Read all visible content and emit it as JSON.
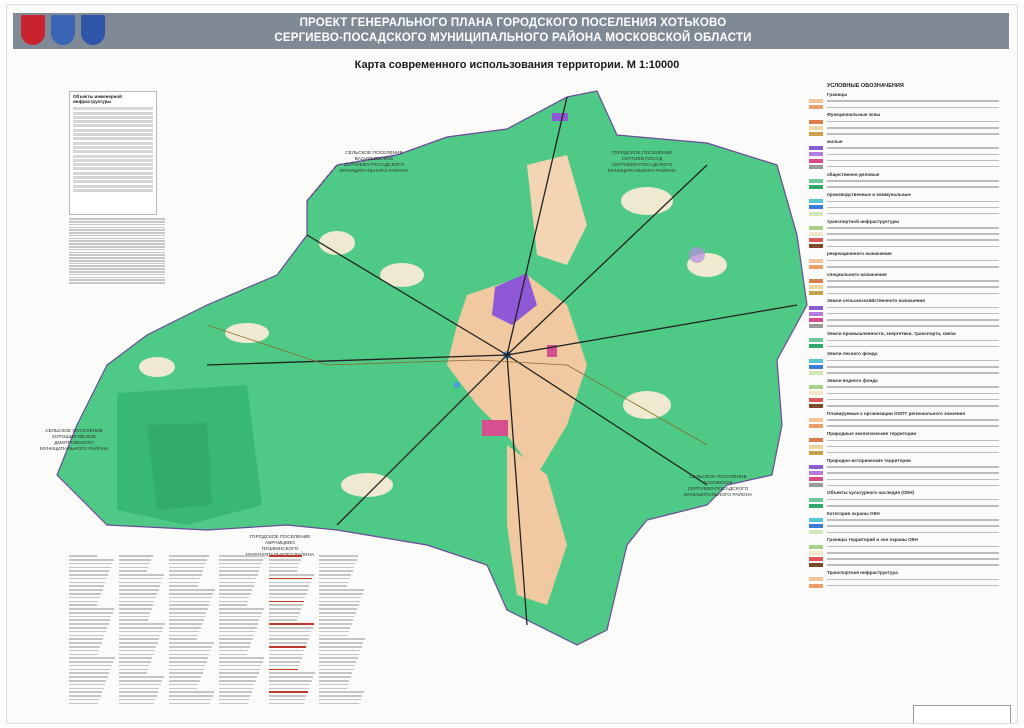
{
  "header": {
    "line1": "ПРОЕКТ ГЕНЕРАЛЬНОГО ПЛАНА ГОРОДСКОГО ПОСЕЛЕНИЯ ХОТЬКОВО",
    "line2": "СЕРГИЕВО-ПОСАДСКОГО МУНИЦИПАЛЬНОГО РАЙОНА МОСКОВСКОЙ ОБЛАСТИ"
  },
  "subtitle": "Карта современного использования территории. М 1:10000",
  "legend_left_title": "Объекты инженерной инфраструктуры",
  "legend_right": {
    "title": "УСЛОВНЫЕ ОБОЗНАЧЕНИЯ",
    "groups": [
      "Границы",
      "Функциональные зоны",
      "жилые",
      "общественно-деловые",
      "производственные и коммунальные",
      "транспортной инфраструктуры",
      "рекреационного назначения",
      "специального назначения",
      "Земли сельскохозяйственного назначения",
      "Земли промышленности, энергетики, транспорта, связи",
      "Земли лесного фонда",
      "Земли водного фонда",
      "Планируемые к организации ООПТ регионального значения",
      "Природные экологические территории",
      "Природно-исторические территории",
      "Объекты культурного наследия (ОКН)",
      "Категория охраны ОКН",
      "Границы территорий и зон охраны ОКН",
      "Транспортная инфраструктура"
    ],
    "swatches": [
      "#f4c49a",
      "#e8a06a",
      "#d97d4a",
      "#e9d8a6",
      "#c9a24a",
      "#8f5bd6",
      "#b57be0",
      "#d94b8b",
      "#9a9a9a",
      "#6dc99a",
      "#2fa86a",
      "#58c7d8",
      "#3a7bd5",
      "#d4e6b5",
      "#a8d08d",
      "#f1e6c8",
      "#e25656",
      "#7a4b2a"
    ]
  },
  "map_labels": {
    "nw": [
      "СЕЛЬСКОЕ ПОСЕЛЕНИЕ",
      "ВАСИЛЬЕВСКОЕ",
      "СЕРГИЕВО-ПОСАДСКОГО",
      "МУНИЦИПАЛЬНОГО РАЙОНА"
    ],
    "ne": [
      "ГОРОДСКОЕ ПОСЕЛЕНИЕ",
      "СЕРГИЕВ ПОСАД",
      "СЕРГИЕВО-ПОСАДСКОГО",
      "МУНИЦИПАЛЬНОГО РАЙОНА"
    ],
    "w": [
      "СЕЛЬСКОЕ ПОСЕЛЕНИЕ",
      "ХОРОШИЛОВСКОЕ",
      "ДМИТРОВСКОГО",
      "МУНИЦИПАЛЬНОГО РАЙОНА"
    ],
    "s": [
      "ГОРОДСКОЕ ПОСЕЛЕНИЕ",
      "АБРАМЦЕВО",
      "ПУШКИНСКОГО",
      "МУНИЦИПАЛЬНОГО РАЙОНА"
    ],
    "se": [
      "СЕЛЬСКОЕ ПОСЕЛЕНИЕ",
      "ЛОЗОВСКОЕ",
      "СЕРГИЕВО-ПОСАДСКОГО",
      "МУНИЦИПАЛЬНОГО РАЙОНА"
    ]
  },
  "colors": {
    "forest": "#4fca86",
    "forest_dark": "#39b874",
    "agricultural": "#efe9cf",
    "residential": "#f0c9a0",
    "industrial": "#8e58d6",
    "public": "#d64f8e",
    "water": "#4a9de0",
    "header_bg": "#7f8a96"
  }
}
